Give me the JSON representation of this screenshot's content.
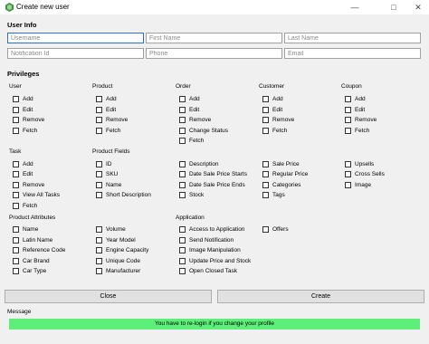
{
  "window": {
    "title": "Create new user"
  },
  "user_info": {
    "heading": "User Info",
    "row1": [
      {
        "placeholder": "Username"
      },
      {
        "placeholder": "First Name"
      },
      {
        "placeholder": "Last Name"
      }
    ],
    "row2": [
      {
        "placeholder": "Notification Id"
      },
      {
        "placeholder": "Phone"
      },
      {
        "placeholder": "Email"
      }
    ]
  },
  "privileges": {
    "heading": "Privileges",
    "groups": {
      "user": {
        "label": "User",
        "items": [
          "Add",
          "Edit",
          "Remove",
          "Fetch"
        ]
      },
      "product": {
        "label": "Product",
        "items": [
          "Add",
          "Edit",
          "Remove",
          "Fetch"
        ]
      },
      "order": {
        "label": "Order",
        "items": [
          "Add",
          "Edit",
          "Remove",
          "Change Status",
          "Fetch"
        ]
      },
      "customer": {
        "label": "Customer",
        "items": [
          "Add",
          "Edit",
          "Remove",
          "Fetch"
        ]
      },
      "coupon": {
        "label": "Coupon",
        "items": [
          "Add",
          "Edit",
          "Remove",
          "Fetch"
        ]
      },
      "task": {
        "label": "Task",
        "items": [
          "Add",
          "Edit",
          "Remove",
          "View All Tasks",
          "Fetch"
        ]
      },
      "product_fields": {
        "label": "Product Fields",
        "col1": [
          "ID",
          "SKU",
          "Name",
          "Short Description"
        ],
        "col2": [
          "Description",
          "Date Sale Price Starts",
          "Date Sale Price Ends",
          "Stock"
        ],
        "col3": [
          "Sale Price",
          "Regular Price",
          "Categories",
          "Tags"
        ],
        "col4": [
          "Upsells",
          "Cross Sells",
          "Image"
        ]
      },
      "product_attributes": {
        "label": "Product Attributes",
        "col1": [
          "Name",
          "Latin Name",
          "Reference Code",
          "Car Brand",
          "Car Type"
        ],
        "col2": [
          "Volume",
          "Year Model",
          "Engine Capacity",
          "Unique Code",
          "Manufacturer"
        ]
      },
      "application": {
        "label": "Application",
        "col1": [
          "Access to Application",
          "Send Notification",
          "Image Manipulation",
          "Update Price and Stock",
          "Open Closed Task"
        ],
        "col2": [
          "Offers"
        ]
      }
    }
  },
  "buttons": {
    "close": "Close",
    "create": "Create"
  },
  "message": {
    "heading": "Message",
    "text": "You have to re-login if you change your profile"
  },
  "colors": {
    "message_bg": "#5eef7b",
    "focus_border": "#2a6fd6"
  }
}
